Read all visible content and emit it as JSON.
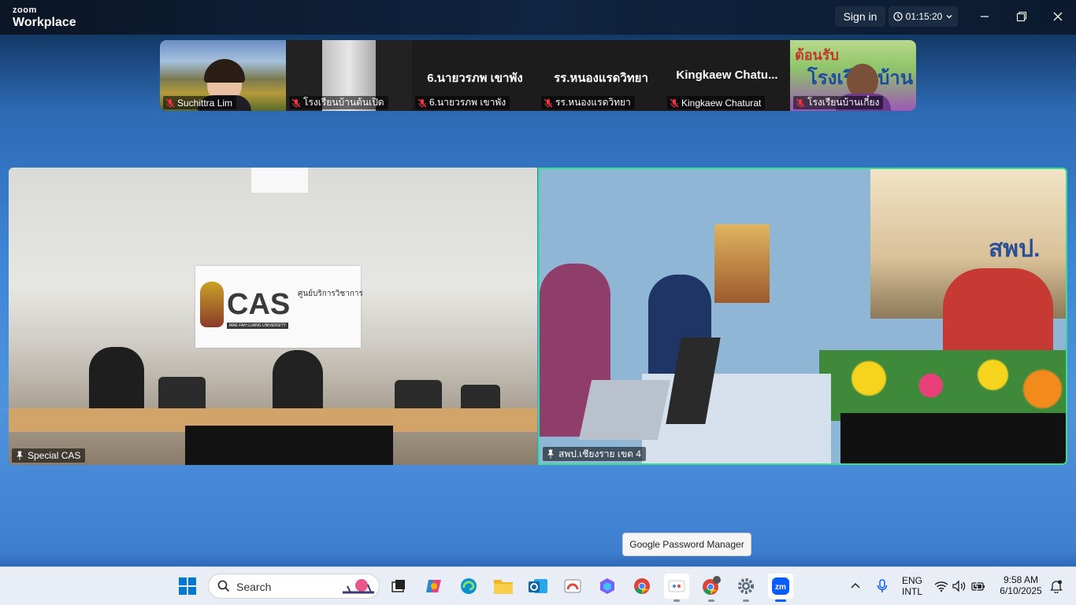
{
  "app": {
    "brand_top": "zoom",
    "brand_bottom": "Workplace"
  },
  "titlebar": {
    "sign_in": "Sign in",
    "timer": "01:15:20"
  },
  "gallery": [
    {
      "name": "Suchittra Lim",
      "big": ""
    },
    {
      "name": "โรงเรียนบ้านต้นเปิด",
      "big": ""
    },
    {
      "name": "6.นายวรภพ เขาพัง",
      "big": "6.นายวรภพ เขาพัง"
    },
    {
      "name": "รร.หนองแรดวิทยา",
      "big": "รร.หนองแรดวิทยา"
    },
    {
      "name": "Kingkaew Chaturat",
      "big": "Kingkaew  Chatu..."
    },
    {
      "name": "โรงเรียนบ้านเกี๋ยง",
      "big": ""
    }
  ],
  "main_videos": [
    {
      "name": "Special CAS",
      "sign_logo": "CAS",
      "sign_sub": "MAE FAH LUANG UNIVERSITY",
      "sign_thai": "ศูนย์บริการวิชาการ"
    },
    {
      "name": "สพป.เชียงราย เขต 4",
      "banner": "สพป."
    }
  ],
  "gallery_banner": {
    "line1": "ต้อนรับ",
    "line2": "โรงเรียนบ้าน"
  },
  "tooltip": "Google Password Manager",
  "taskbar": {
    "search_label": "Search",
    "lang_top": "ENG",
    "lang_bottom": "INTL",
    "time": "9:58 AM",
    "date": "6/10/2025"
  },
  "colors": {
    "active_speaker": "#35e08e",
    "zoom_blue": "#0b5cff"
  }
}
